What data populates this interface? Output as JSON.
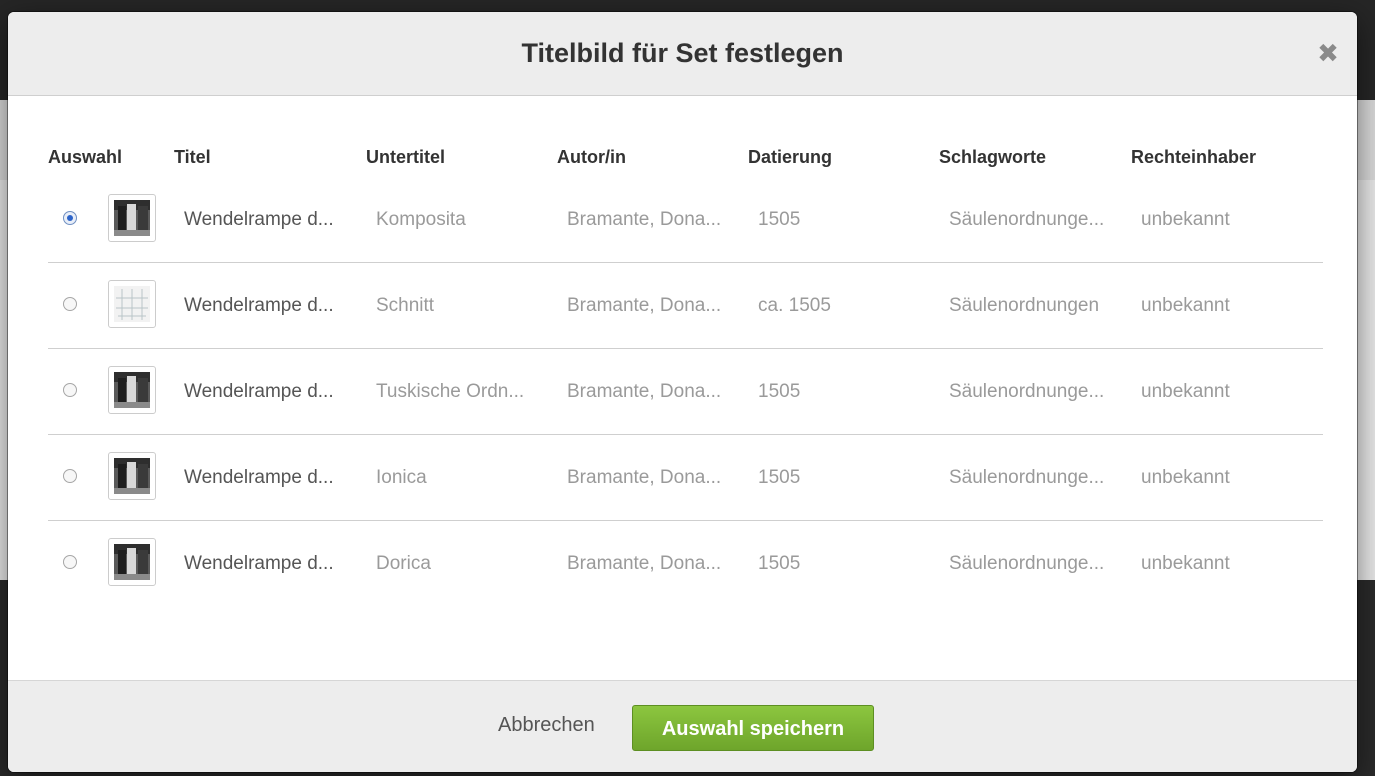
{
  "modal": {
    "title": "Titelbild für Set festlegen",
    "close_glyph": "✖"
  },
  "table": {
    "headers": [
      "Auswahl",
      "Titel",
      "Untertitel",
      "Autor/in",
      "Datierung",
      "Schlagworte",
      "Rechteinhaber"
    ],
    "rows": [
      {
        "selected": true,
        "thumbnail": "photo-column-dark",
        "titel": "Wendelrampe d...",
        "untertitel": "Komposita",
        "autor": "Bramante, Dona...",
        "datierung": "1505",
        "schlagworte": "Säulenordnunge...",
        "rechteinhaber": "unbekannt"
      },
      {
        "selected": false,
        "thumbnail": "drawing-section",
        "titel": "Wendelrampe d...",
        "untertitel": "Schnitt",
        "autor": "Bramante, Dona...",
        "datierung": "ca. 1505",
        "schlagworte": "Säulenordnungen",
        "rechteinhaber": "unbekannt"
      },
      {
        "selected": false,
        "thumbnail": "photo-column-dark",
        "titel": "Wendelrampe d...",
        "untertitel": "Tuskische Ordn...",
        "autor": "Bramante, Dona...",
        "datierung": "1505",
        "schlagworte": "Säulenordnunge...",
        "rechteinhaber": "unbekannt"
      },
      {
        "selected": false,
        "thumbnail": "photo-column-dark",
        "titel": "Wendelrampe d...",
        "untertitel": "Ionica",
        "autor": "Bramante, Dona...",
        "datierung": "1505",
        "schlagworte": "Säulenordnunge...",
        "rechteinhaber": "unbekannt"
      },
      {
        "selected": false,
        "thumbnail": "photo-column-dark",
        "titel": "Wendelrampe d...",
        "untertitel": "Dorica",
        "autor": "Bramante, Dona...",
        "datierung": "1505",
        "schlagworte": "Säulenordnunge...",
        "rechteinhaber": "unbekannt"
      }
    ]
  },
  "footer": {
    "cancel_label": "Abbrechen",
    "save_label": "Auswahl speichern"
  },
  "colors": {
    "accent_green": "#7ab534",
    "radio_selected": "#2c63c9"
  }
}
